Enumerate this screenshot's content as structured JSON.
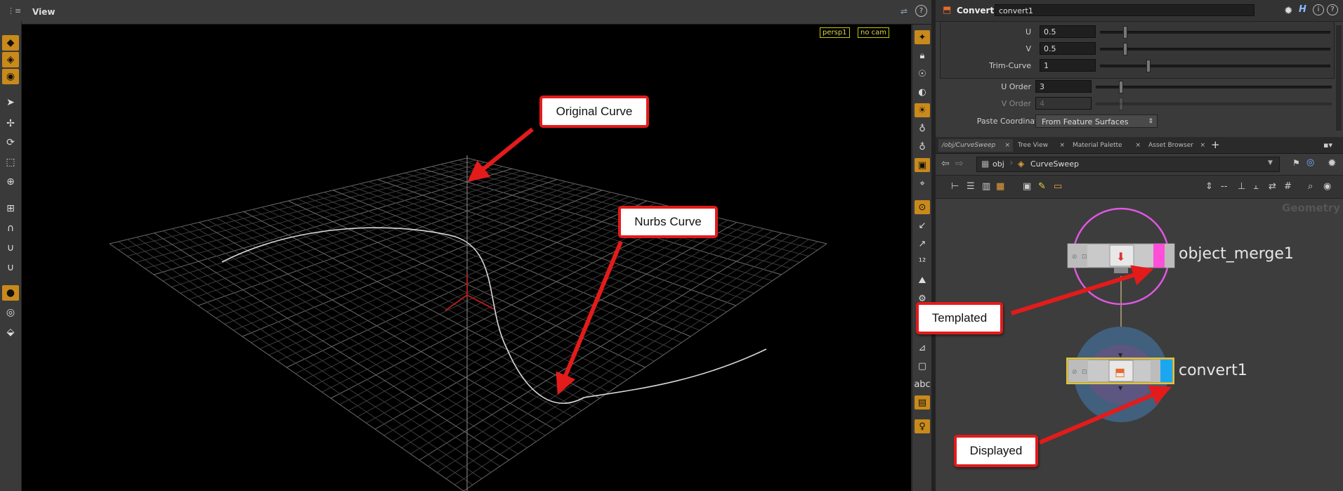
{
  "viewer": {
    "title": "View",
    "camera_chip": "persp1",
    "cam_chip": "no cam",
    "help_glyph": "?"
  },
  "params": {
    "node_type": "Convert",
    "node_name": "convert1",
    "rows": [
      {
        "label": "U",
        "value": "0.5"
      },
      {
        "label": "V",
        "value": "0.5"
      },
      {
        "label": "Trim-Curve",
        "value": "1"
      },
      {
        "label": "U Order",
        "value": "3"
      },
      {
        "label": "V Order",
        "value": "4"
      }
    ],
    "paste_label": "Paste Coordinates",
    "paste_value": "From Feature Surfaces",
    "header_h_icon": "H"
  },
  "tabs": [
    {
      "label": "/obj/CurveSweep",
      "close": "×"
    },
    {
      "label": "Tree View",
      "close": "×"
    },
    {
      "label": "Material Palette",
      "close": "×"
    },
    {
      "label": "Asset Browser",
      "close": "×"
    }
  ],
  "tab_add": "+",
  "path": {
    "root": "obj",
    "current": "CurveSweep"
  },
  "network": {
    "context_watermark": "Geometry",
    "nodes": [
      {
        "name": "object_merge1"
      },
      {
        "name": "convert1"
      }
    ]
  },
  "callouts": {
    "original_curve": "Original Curve",
    "nurbs_curve": "Nurbs Curve",
    "templated": "Templated",
    "displayed": "Displayed"
  },
  "viewport_extra": {
    "abc_label": "abc"
  },
  "colors": {
    "accent_orange": "#c98a1b",
    "callout_red": "#e31b1b",
    "template_flag": "#ff4fd8",
    "display_flag": "#1aa7ef",
    "chip_yellow": "#d8d84a"
  },
  "icons": [
    "pin-icon",
    "lock-icon",
    "gear-icon",
    "help-icon",
    "back-arrow-icon",
    "forward-arrow-icon",
    "search-icon",
    "select-arrow-icon",
    "magnet-icon",
    "camera-icon",
    "light-icon",
    "grid-icon"
  ]
}
